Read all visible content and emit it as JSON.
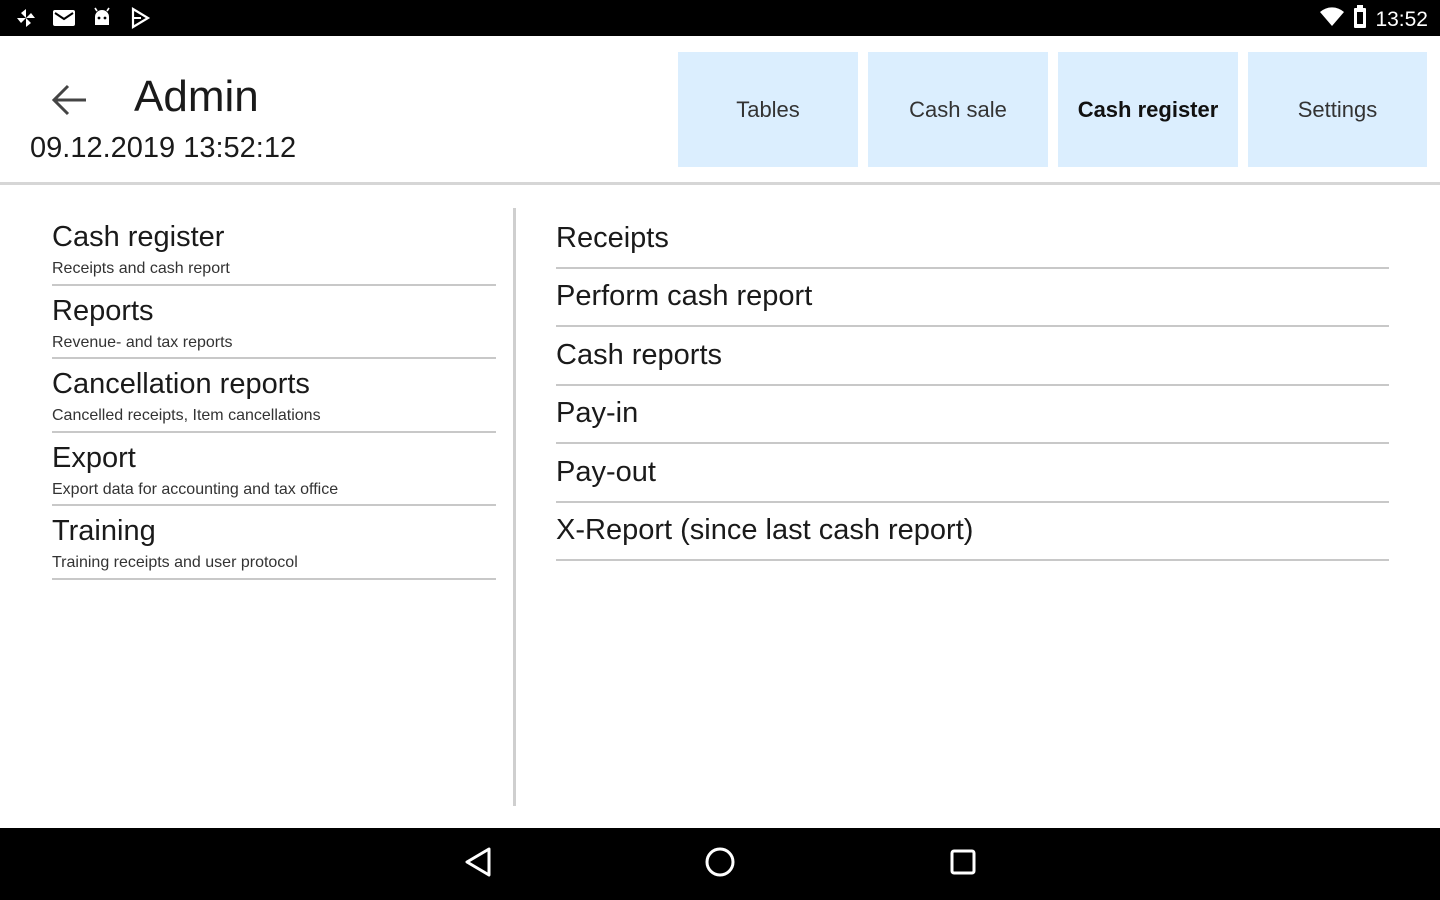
{
  "status_bar": {
    "time": "13:52",
    "left_icons": [
      "pinwheel-icon",
      "mail-icon",
      "android-icon",
      "play-store-icon"
    ],
    "right_icons": [
      "wifi-icon",
      "battery-icon"
    ]
  },
  "header": {
    "title": "Admin",
    "datetime": "09.12.2019 13:52:12",
    "tabs": [
      {
        "label": "Tables"
      },
      {
        "label": "Cash sale"
      },
      {
        "label": "Cash register"
      },
      {
        "label": "Settings"
      }
    ],
    "active_tab": "Cash register",
    "tab_color": "#dbeefe"
  },
  "left_nav": {
    "items": [
      {
        "title": "Cash register",
        "subtitle": "Receipts and cash report"
      },
      {
        "title": "Reports",
        "subtitle": "Revenue- and tax reports"
      },
      {
        "title": "Cancellation reports",
        "subtitle": "Cancelled receipts, Item cancellations"
      },
      {
        "title": "Export",
        "subtitle": "Export data for accounting and tax office"
      },
      {
        "title": "Training",
        "subtitle": "Training receipts and user protocol"
      }
    ]
  },
  "right_list": {
    "items": [
      {
        "label": "Receipts"
      },
      {
        "label": "Perform cash report"
      },
      {
        "label": "Cash reports"
      },
      {
        "label": "Pay-in"
      },
      {
        "label": "Pay-out"
      },
      {
        "label": "X-Report (since last cash report)"
      }
    ]
  },
  "nav_bar": {
    "buttons": [
      "back-triangle-icon",
      "home-circle-icon",
      "recents-square-icon"
    ]
  }
}
